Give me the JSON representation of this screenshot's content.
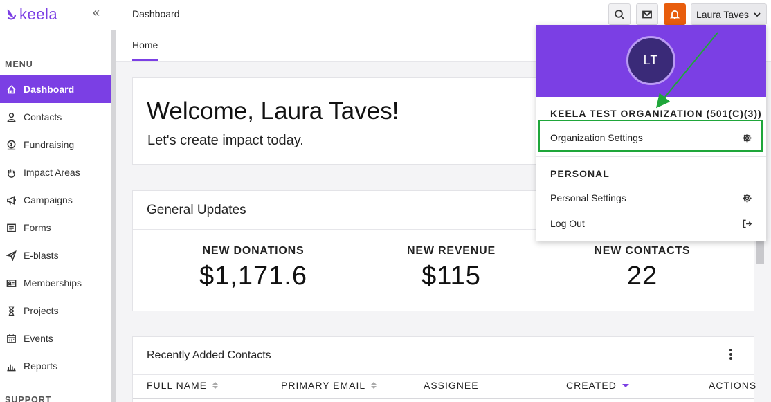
{
  "brand": {
    "name": "keela",
    "color": "#7b3fe4"
  },
  "sidebar": {
    "menu_heading": "MENU",
    "support_heading": "SUPPORT",
    "items": [
      {
        "label": "Dashboard",
        "icon": "home-icon",
        "active": true
      },
      {
        "label": "Contacts",
        "icon": "person-icon"
      },
      {
        "label": "Fundraising",
        "icon": "donation-icon"
      },
      {
        "label": "Impact Areas",
        "icon": "hand-icon"
      },
      {
        "label": "Campaigns",
        "icon": "megaphone-icon"
      },
      {
        "label": "Forms",
        "icon": "form-icon"
      },
      {
        "label": "E-blasts",
        "icon": "paper-plane-icon"
      },
      {
        "label": "Memberships",
        "icon": "id-card-icon"
      },
      {
        "label": "Projects",
        "icon": "hourglass-icon"
      },
      {
        "label": "Events",
        "icon": "calendar-icon"
      },
      {
        "label": "Reports",
        "icon": "bar-chart-icon"
      }
    ]
  },
  "header": {
    "title": "Dashboard",
    "user_name": "Laura Taves",
    "notification_color": "#e85d0c"
  },
  "tabs": [
    {
      "label": "Home"
    }
  ],
  "welcome": {
    "title": "Welcome, Laura Taves!",
    "subtitle": "Let's create impact today."
  },
  "updates": {
    "title": "General Updates",
    "stats": [
      {
        "label": "NEW DONATIONS",
        "value": "$1,171.6"
      },
      {
        "label": "NEW REVENUE",
        "value": "$115"
      },
      {
        "label": "NEW CONTACTS",
        "value": "22"
      }
    ]
  },
  "recent_contacts": {
    "title": "Recently Added Contacts",
    "columns": [
      "FULL NAME",
      "PRIMARY EMAIL",
      "ASSIGNEE",
      "CREATED",
      "ACTIONS"
    ]
  },
  "dropdown": {
    "initials": "LT",
    "org_heading": "KEELA TEST ORGANIZATION (501(C)(3))",
    "org_settings": "Organization Settings",
    "personal_heading": "PERSONAL",
    "personal_settings": "Personal Settings",
    "logout": "Log Out"
  },
  "annotation": {
    "highlight_color": "#1fa63a"
  }
}
